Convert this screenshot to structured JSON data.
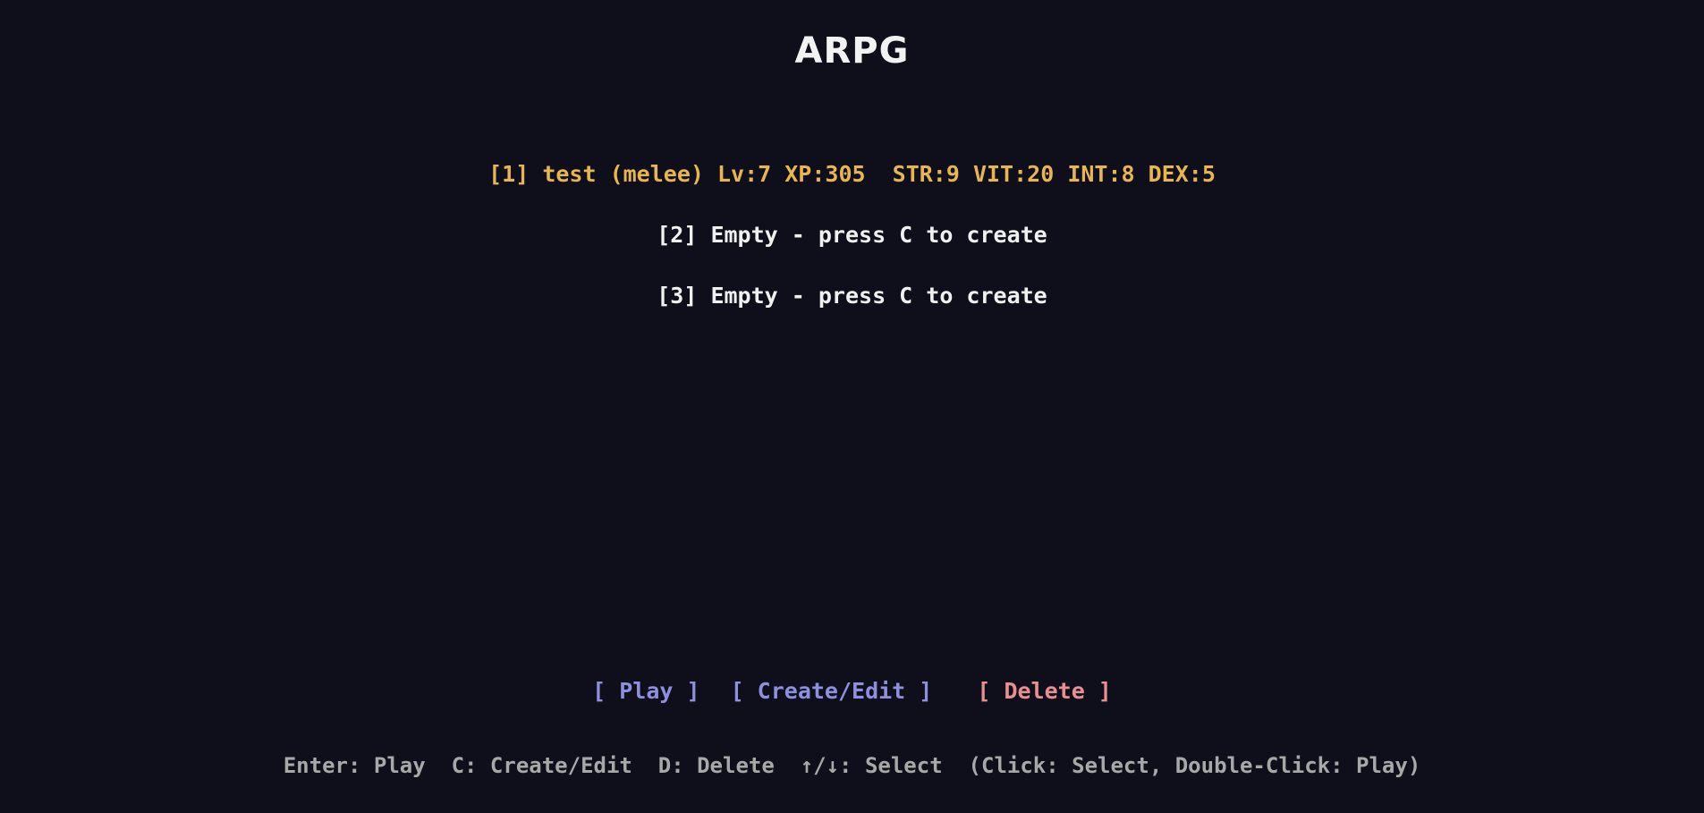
{
  "title": "ARPG",
  "slots": [
    {
      "label": "[1] test (melee) Lv:7 XP:305  STR:9 VIT:20 INT:8 DEX:5",
      "selected": true
    },
    {
      "label": "[2] Empty - press C to create",
      "selected": false
    },
    {
      "label": "[3] Empty - press C to create",
      "selected": false
    }
  ],
  "buttons": {
    "play": "[ Play ]",
    "create_edit": "[ Create/Edit ]",
    "delete": "[ Delete ]"
  },
  "hint": "Enter: Play  C: Create/Edit  D: Delete  ↑/↓: Select  (Click: Select, Double-Click: Play)",
  "colors": {
    "background": "#0e0f1a",
    "selected_slot": "#e8b54f",
    "slot_text": "#f0f0f0",
    "button_primary": "#8f8fe0",
    "button_danger": "#e88f8f",
    "hint_text": "#a8a8a8"
  }
}
